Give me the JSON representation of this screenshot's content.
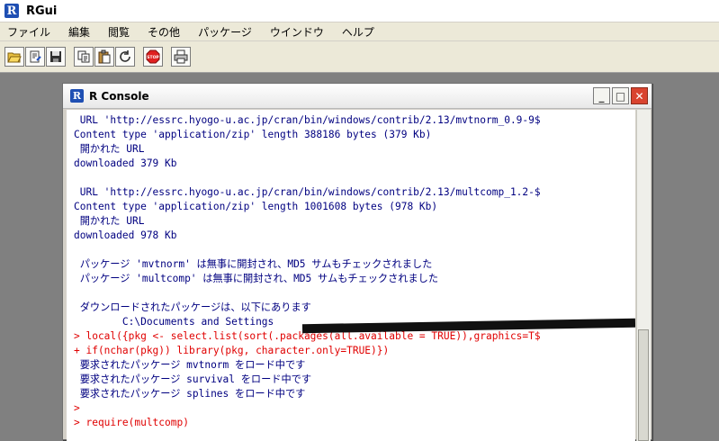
{
  "app": {
    "title": "RGui",
    "logo": "R"
  },
  "menu": [
    "ファイル",
    "編集",
    "閲覧",
    "その他",
    "パッケージ",
    "ウインドウ",
    "ヘルプ"
  ],
  "toolbar": {
    "icons": [
      "open-script-icon",
      "load-workspace-icon",
      "save-icon",
      "copy-icon",
      "paste-icon",
      "copy-paste-icon",
      "stop-icon",
      "print-icon"
    ],
    "stop_label": "STOP"
  },
  "console": {
    "title": "R Console",
    "logo": "R",
    "controls": {
      "minimize": "_",
      "maximize": "□",
      "close": "✕"
    },
    "lines": [
      {
        "text": " URL 'http://essrc.hyogo-u.ac.jp/cran/bin/windows/contrib/2.13/mvtnorm_0.9-9$",
        "kind": "out"
      },
      {
        "text": "Content type 'application/zip' length 388186 bytes (379 Kb)",
        "kind": "out"
      },
      {
        "text": " 開かれた URL",
        "kind": "out"
      },
      {
        "text": "downloaded 379 Kb",
        "kind": "out"
      },
      {
        "text": "",
        "kind": "blank"
      },
      {
        "text": " URL 'http://essrc.hyogo-u.ac.jp/cran/bin/windows/contrib/2.13/multcomp_1.2-$",
        "kind": "out"
      },
      {
        "text": "Content type 'application/zip' length 1001608 bytes (978 Kb)",
        "kind": "out"
      },
      {
        "text": " 開かれた URL",
        "kind": "out"
      },
      {
        "text": "downloaded 978 Kb",
        "kind": "out"
      },
      {
        "text": "",
        "kind": "blank"
      },
      {
        "text": " パッケージ 'mvtnorm' は無事に開封され、MD5 サムもチェックされました",
        "kind": "out"
      },
      {
        "text": " パッケージ 'multcomp' は無事に開封され、MD5 サムもチェックされました",
        "kind": "out"
      },
      {
        "text": "",
        "kind": "blank"
      },
      {
        "text": " ダウンロードされたパッケージは、以下にあります",
        "kind": "out"
      },
      {
        "text": "        C:\\Documents and Settings",
        "kind": "out"
      },
      {
        "text": "> local({pkg <- select.list(sort(.packages(all.available = TRUE)),graphics=T$",
        "kind": "cmd"
      },
      {
        "text": "+ if(nchar(pkg)) library(pkg, character.only=TRUE)})",
        "kind": "cmd"
      },
      {
        "text": " 要求されたパッケージ mvtnorm をロード中です",
        "kind": "out"
      },
      {
        "text": " 要求されたパッケージ survival をロード中です",
        "kind": "out"
      },
      {
        "text": " 要求されたパッケージ splines をロード中です",
        "kind": "out"
      },
      {
        "text": ">",
        "kind": "cmd"
      },
      {
        "text": "> require(multcomp)",
        "kind": "cmd"
      }
    ]
  }
}
